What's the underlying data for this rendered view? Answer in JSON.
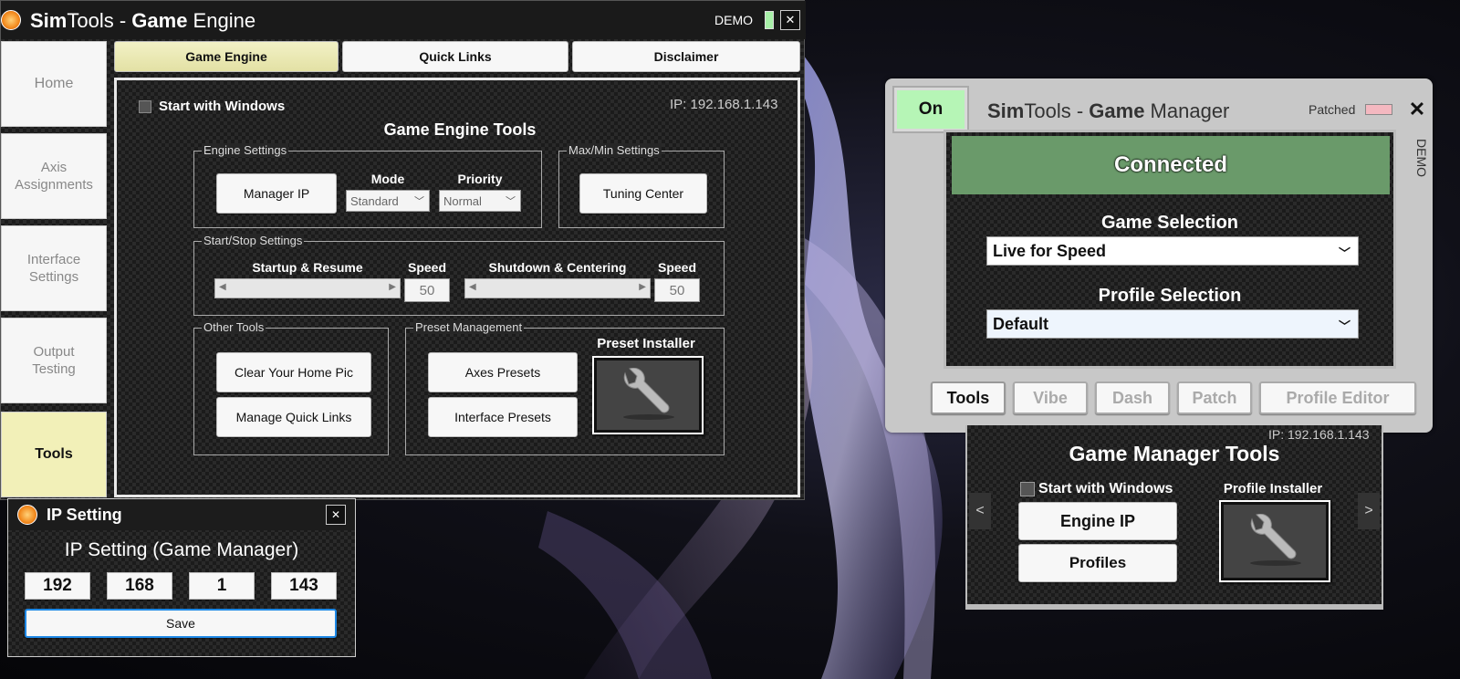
{
  "engine_window": {
    "title_bold_a": "Sim",
    "title_a": "Tools - ",
    "title_bold_b": "Game",
    "title_b": " Engine",
    "demo_label": "DEMO",
    "close_glyph": "✕",
    "sidebar": [
      {
        "label_1": "Home",
        "label_2": ""
      },
      {
        "label_1": "Axis",
        "label_2": "Assignments"
      },
      {
        "label_1": "Interface",
        "label_2": "Settings"
      },
      {
        "label_1": "Output",
        "label_2": "Testing"
      },
      {
        "label_1": "Tools",
        "label_2": ""
      }
    ],
    "tabs": [
      "Game Engine",
      "Quick Links",
      "Disclaimer"
    ],
    "start_with_windows": "Start with Windows",
    "ip_text": "IP: 192.168.1.143",
    "tools_title": "Game Engine Tools",
    "engine_settings": {
      "legend": "Engine Settings",
      "manager_ip": "Manager IP",
      "mode_label": "Mode",
      "mode_value": "Standard",
      "priority_label": "Priority",
      "priority_value": "Normal"
    },
    "maxmin_settings": {
      "legend": "Max/Min Settings",
      "tuning_center": "Tuning Center"
    },
    "startstop_settings": {
      "legend": "Start/Stop Settings",
      "startup_label": "Startup & Resume",
      "speed_label_1": "Speed",
      "speed_value_1": "50",
      "shutdown_label": "Shutdown & Centering",
      "speed_label_2": "Speed",
      "speed_value_2": "50"
    },
    "other_tools": {
      "legend": "Other Tools",
      "clear_pic": "Clear Your Home Pic",
      "manage_links": "Manage Quick Links"
    },
    "preset_management": {
      "legend": "Preset Management",
      "axes_presets": "Axes Presets",
      "interface_presets": "Interface Presets",
      "installer_label": "Preset Installer"
    },
    "colors": {
      "active_tab": "#efeeb5",
      "active_sidebar": "#f2f0b8"
    }
  },
  "ip_dialog": {
    "title": "IP Setting",
    "close_glyph": "✕",
    "heading": "IP Setting (Game Manager)",
    "octets": [
      "192",
      "168",
      "1",
      "143"
    ],
    "save": "Save"
  },
  "manager_window": {
    "on_label": "On",
    "title_bold_a": "Sim",
    "title_a": "Tools - ",
    "title_bold_b": "Game",
    "title_b": " Manager",
    "patched_label": "Patched",
    "close_glyph": "✕",
    "demo_vertical": "DEMO",
    "status": "Connected",
    "game_selection_label": "Game Selection",
    "game_selection_value": "Live for Speed",
    "profile_selection_label": "Profile Selection",
    "profile_selection_value": "Default",
    "tabs": [
      "Tools",
      "Vibe",
      "Dash",
      "Patch",
      "Profile Editor"
    ],
    "ip_text": "IP: 192.168.1.143",
    "tools_title": "Game Manager Tools",
    "start_with_windows": "Start with Windows",
    "profile_installer": "Profile Installer",
    "engine_ip": "Engine IP",
    "profiles": "Profiles",
    "nav_prev": "<",
    "nav_next": ">",
    "colors": {
      "connected": "#6a9a6a",
      "on_button": "#b6f5b6",
      "patched_indicator": "#f4b8c0"
    }
  }
}
